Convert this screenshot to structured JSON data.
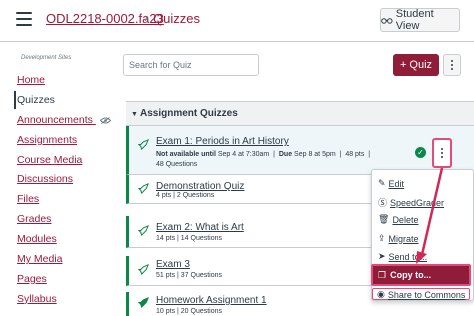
{
  "header": {
    "course": "ODL2218-0002.fa23",
    "separator": "›",
    "page": "Quizzes",
    "student_view": "Student View"
  },
  "sidebar": {
    "caption": "Development Sites",
    "items": [
      {
        "label": "Home"
      },
      {
        "label": "Quizzes"
      },
      {
        "label": "Announcements"
      },
      {
        "label": "Assignments"
      },
      {
        "label": "Course Media"
      },
      {
        "label": "Discussions"
      },
      {
        "label": "Files"
      },
      {
        "label": "Grades"
      },
      {
        "label": "Modules"
      },
      {
        "label": "My Media"
      },
      {
        "label": "Pages"
      },
      {
        "label": "Syllabus"
      }
    ]
  },
  "toolbar": {
    "search_placeholder": "Search for Quiz",
    "add_label": "Quiz",
    "add_icon": "+"
  },
  "group": {
    "title": "Assignment Quizzes"
  },
  "quizzes": [
    {
      "title": "Exam 1: Periods in Art History",
      "avail_label": "Not available until",
      "avail_value": "Sep 4 at 7:30am",
      "due_label": "Due",
      "due_value": "Sep 8 at 5pm",
      "points": "48 pts",
      "questions": "48 Questions"
    },
    {
      "title": "Demonstration Quiz",
      "meta": "4 pts | 2 Questions"
    },
    {
      "title": "Exam 2: What is Art",
      "meta": "14 pts | 14 Questions"
    },
    {
      "title": "Exam 3",
      "meta": "51 pts | 37 Questions"
    },
    {
      "title": "Homework Assignment 1",
      "meta": "10 pts | 20 Questions"
    }
  ],
  "menu": {
    "items": [
      {
        "label": "Edit",
        "icon": "pencil-icon"
      },
      {
        "label": "SpeedGrader",
        "icon": "speedgrader-icon"
      },
      {
        "label": "Delete",
        "icon": "trash-icon"
      },
      {
        "label": "Migrate",
        "icon": "migrate-icon"
      },
      {
        "label": "Send to...",
        "icon": "send-icon"
      },
      {
        "label": "Copy to...",
        "icon": "copy-icon"
      },
      {
        "label": "Share to Commons",
        "icon": "commons-icon"
      }
    ]
  },
  "colors": {
    "brand": "#8f1d3a",
    "link": "#9e1a3a",
    "highlight": "#e34b7a",
    "published": "#0b874b"
  }
}
